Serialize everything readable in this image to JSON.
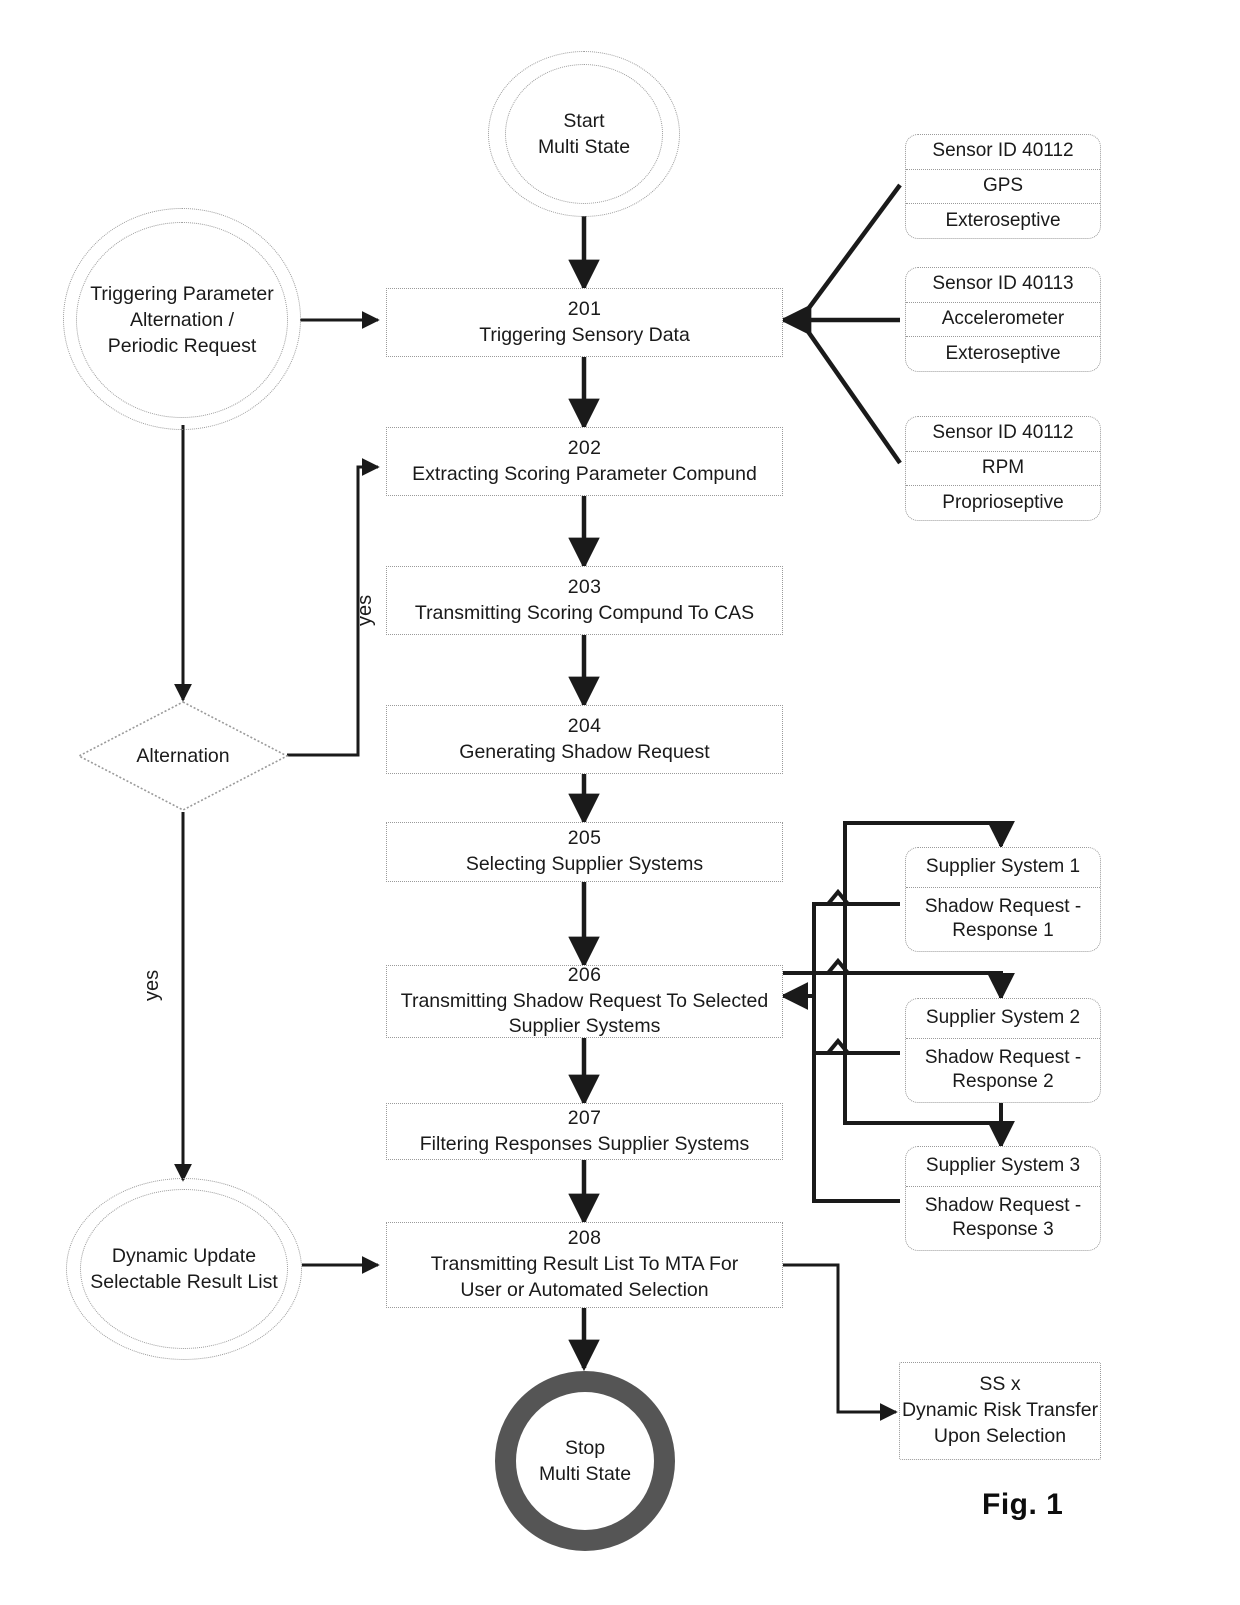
{
  "figure": {
    "caption": "Fig. 1"
  },
  "terminators": {
    "start": {
      "line1": "Start",
      "line2": "Multi State"
    },
    "stop": {
      "line1": "Stop",
      "line2": "Multi State"
    },
    "trigger": {
      "line1": "Triggering Parameter",
      "line2": "Alternation /",
      "line3": "Periodic Request"
    },
    "dynamic_update": {
      "line1": "Dynamic Update",
      "line2": "Selectable Result List"
    }
  },
  "decision": {
    "alternation": {
      "label": "Alternation",
      "branch_right_label": "yes",
      "branch_down_label": "yes"
    }
  },
  "steps": [
    {
      "num": "201",
      "label": "Triggering Sensory Data"
    },
    {
      "num": "202",
      "label": "Extracting Scoring Parameter Compund"
    },
    {
      "num": "203",
      "label": "Transmitting Scoring Compund To CAS"
    },
    {
      "num": "204",
      "label": "Generating Shadow Request"
    },
    {
      "num": "205",
      "label": "Selecting Supplier Systems"
    },
    {
      "num": "206",
      "label_line1": "Transmitting Shadow Request To Selected",
      "label_line2": "Supplier Systems"
    },
    {
      "num": "207",
      "label": "Filtering Responses Supplier Systems"
    },
    {
      "num": "208",
      "label_line1": "Transmitting Result List To MTA For",
      "label_line2": "User or Automated Selection"
    }
  ],
  "sensors": [
    {
      "id_label": "Sensor ID  40112",
      "type": "GPS",
      "category": "Exteroseptive"
    },
    {
      "id_label": "Sensor ID  40113",
      "type": "Accelerometer",
      "category": "Exteroseptive"
    },
    {
      "id_label": "Sensor ID  40112",
      "type": "RPM",
      "category": "Proprioseptive"
    }
  ],
  "supplier_systems": [
    {
      "name": "Supplier System 1",
      "response_line1": "Shadow Request  -",
      "response_line2": "Response 1"
    },
    {
      "name": "Supplier System 2",
      "response_line1": "Shadow Request -",
      "response_line2": "Response 2"
    },
    {
      "name": "Supplier System 3",
      "response_line1": "Shadow Request -",
      "response_line2": "Response 3"
    }
  ],
  "outcome": {
    "line1": "SS x",
    "line2": "Dynamic Risk Transfer",
    "line3": "Upon Selection"
  },
  "colors": {
    "line": "#1a1a1a",
    "box_border": "#9a9a9a",
    "stop_ring": "#555555",
    "background": "#ffffff"
  }
}
